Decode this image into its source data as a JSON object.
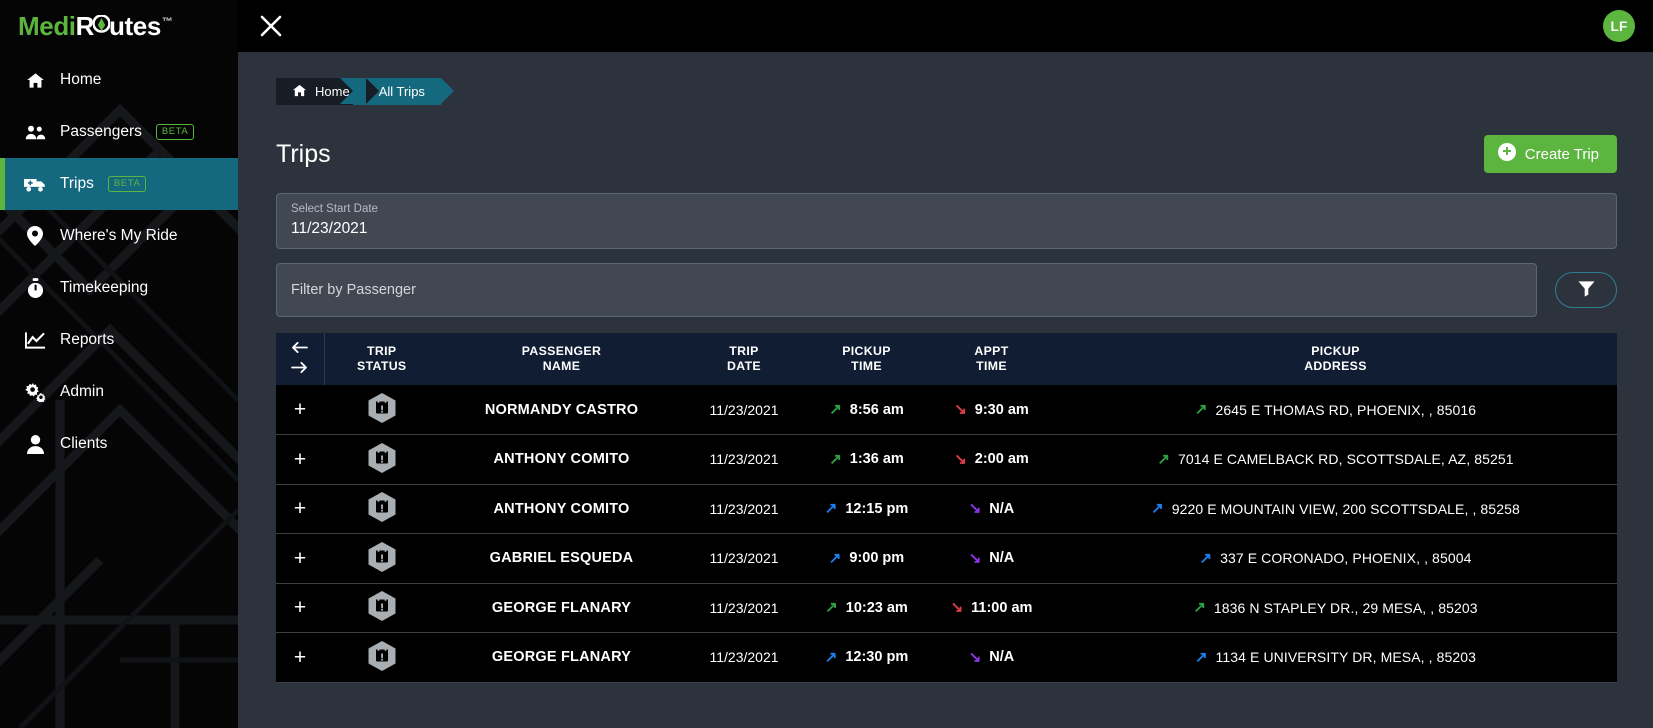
{
  "brand": {
    "logo_medi": "Medi",
    "logo_r": "R",
    "logo_utes": "utes",
    "logo_tm": "™",
    "accent_green": "#5cb53f",
    "accent_teal": "#15697f"
  },
  "topbar": {
    "close_icon": "close-icon",
    "avatar_initials": "LF"
  },
  "sidebar": {
    "items": [
      {
        "label": "Home",
        "icon": "home-icon",
        "badge": "",
        "active": false
      },
      {
        "label": "Passengers",
        "icon": "people-icon",
        "badge": "BETA",
        "active": false
      },
      {
        "label": "Trips",
        "icon": "ambulance-icon",
        "badge": "BETA",
        "active": true
      },
      {
        "label": "Where's My Ride",
        "icon": "map-pin-icon",
        "badge": "",
        "active": false
      },
      {
        "label": "Timekeeping",
        "icon": "stopwatch-icon",
        "badge": "",
        "active": false
      },
      {
        "label": "Reports",
        "icon": "chart-line-icon",
        "badge": "",
        "active": false
      },
      {
        "label": "Admin",
        "icon": "gears-icon",
        "badge": "",
        "active": false
      },
      {
        "label": "Clients",
        "icon": "user-icon",
        "badge": "",
        "active": false
      }
    ]
  },
  "breadcrumb": {
    "home_label": "Home",
    "home_icon": "home-icon",
    "current_label": "All Trips"
  },
  "page": {
    "title": "Trips",
    "create_button_label": "Create Trip",
    "create_button_icon": "plus-circle-icon"
  },
  "filters": {
    "start_date_label": "Select Start Date",
    "start_date_value": "11/23/2021",
    "passenger_placeholder": "Filter by Passenger",
    "passenger_value": "",
    "filter_button_icon": "funnel-icon"
  },
  "table": {
    "expand_icon_left": "arrow-left-icon",
    "expand_icon_right": "arrow-right-icon",
    "columns": [
      {
        "line1": "TRIP",
        "line2": "STATUS"
      },
      {
        "line1": "PASSENGER",
        "line2": "NAME"
      },
      {
        "line1": "TRIP",
        "line2": "DATE"
      },
      {
        "line1": "PICKUP",
        "line2": "TIME"
      },
      {
        "line1": "APPT",
        "line2": "TIME"
      },
      {
        "line1": "PICKUP",
        "line2": "ADDRESS"
      }
    ],
    "row_expand_label": "+",
    "status_icon": "hexagon-calendar-alert-icon",
    "status_icon_color": "#a9aeb3",
    "rows": [
      {
        "passenger_name": "NORMANDY CASTRO",
        "trip_date": "11/23/2021",
        "pickup_time": "8:56 am",
        "pickup_arrow_color": "#2ea043",
        "appt_time": "9:30 am",
        "appt_arrow_color": "#e03b4a",
        "pickup_address": "2645 E THOMAS RD, PHOENIX, , 85016",
        "address_arrow_color": "#2ea043"
      },
      {
        "passenger_name": "ANTHONY COMITO",
        "trip_date": "11/23/2021",
        "pickup_time": "1:36 am",
        "pickup_arrow_color": "#2ea043",
        "appt_time": "2:00 am",
        "appt_arrow_color": "#e03b4a",
        "pickup_address": "7014 E CAMELBACK RD, SCOTTSDALE, AZ, 85251",
        "address_arrow_color": "#2ea043"
      },
      {
        "passenger_name": "ANTHONY COMITO",
        "trip_date": "11/23/2021",
        "pickup_time": "12:15 pm",
        "pickup_arrow_color": "#1d7ff0",
        "appt_time": "N/A",
        "appt_arrow_color": "#8b35e6",
        "pickup_address": "9220 E MOUNTAIN VIEW, 200 SCOTTSDALE, , 85258",
        "address_arrow_color": "#1d7ff0"
      },
      {
        "passenger_name": "GABRIEL ESQUEDA",
        "trip_date": "11/23/2021",
        "pickup_time": "9:00 pm",
        "pickup_arrow_color": "#1d7ff0",
        "appt_time": "N/A",
        "appt_arrow_color": "#8b35e6",
        "pickup_address": "337 E CORONADO, PHOENIX, , 85004",
        "address_arrow_color": "#1d7ff0"
      },
      {
        "passenger_name": "GEORGE FLANARY",
        "trip_date": "11/23/2021",
        "pickup_time": "10:23 am",
        "pickup_arrow_color": "#2ea043",
        "appt_time": "11:00 am",
        "appt_arrow_color": "#e03b4a",
        "pickup_address": "1836 N STAPLEY DR., 29 MESA, , 85203",
        "address_arrow_color": "#2ea043"
      },
      {
        "passenger_name": "GEORGE FLANARY",
        "trip_date": "11/23/2021",
        "pickup_time": "12:30 pm",
        "pickup_arrow_color": "#1d7ff0",
        "appt_time": "N/A",
        "appt_arrow_color": "#8b35e6",
        "pickup_address": "1134 E UNIVERSITY DR, MESA, , 85203",
        "address_arrow_color": "#1d7ff0"
      }
    ]
  }
}
